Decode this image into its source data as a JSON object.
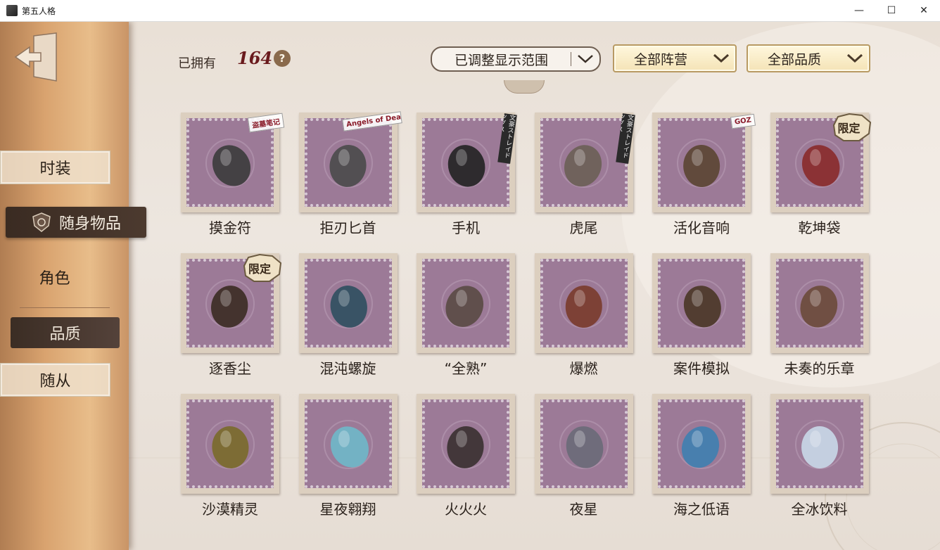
{
  "window": {
    "title": "第五人格",
    "minimize": "—",
    "maximize": "☐",
    "close": "✕"
  },
  "sidebar": {
    "items": [
      {
        "label": "时装",
        "state": "outlined"
      },
      {
        "label": "随身物品",
        "state": "active"
      },
      {
        "label": "角色",
        "state": "plain"
      },
      {
        "label": "品质",
        "state": "sub-active"
      },
      {
        "label": "随从",
        "state": "outlined"
      }
    ]
  },
  "header": {
    "owned_label": "已拥有",
    "owned_count": "164",
    "help": "?",
    "range_dropdown": "已调整显示范围",
    "faction_dropdown": "全部阵营",
    "quality_dropdown": "全部品质"
  },
  "items": [
    {
      "name": "摸金符",
      "tag": "盗墓笔记",
      "tag_style": "logo",
      "icon": "talisman-icon"
    },
    {
      "name": "拒刃匕首",
      "tag": "Angels of Death",
      "tag_style": "logo",
      "icon": "dagger-icon"
    },
    {
      "name": "手机",
      "tag": "文豪ストレイドッグス",
      "tag_style": "banner",
      "icon": "flip-phone-icon"
    },
    {
      "name": "虎尾",
      "tag": "文豪ストレイドッグス",
      "tag_style": "banner",
      "icon": "tiger-tail-icon"
    },
    {
      "name": "活化音响",
      "tag": "GOZ",
      "tag_style": "logo",
      "icon": "radio-icon"
    },
    {
      "name": "乾坤袋",
      "tag": "限定",
      "tag_style": "badge",
      "icon": "bag-icon"
    },
    {
      "name": "逐香尘",
      "tag": "限定",
      "tag_style": "badge",
      "icon": "censer-icon"
    },
    {
      "name": "混沌螺旋",
      "tag": "",
      "tag_style": "",
      "icon": "mirror-icon"
    },
    {
      "name": "“全熟”",
      "tag": "",
      "tag_style": "",
      "icon": "grill-icon"
    },
    {
      "name": "爆燃",
      "tag": "",
      "tag_style": "",
      "icon": "spark-plug-icon"
    },
    {
      "name": "案件模拟",
      "tag": "",
      "tag_style": "",
      "icon": "target-icon"
    },
    {
      "name": "未奏的乐章",
      "tag": "",
      "tag_style": "",
      "icon": "dynamite-icon"
    },
    {
      "name": "沙漠精灵",
      "tag": "",
      "tag_style": "",
      "icon": "dragonfly-icon"
    },
    {
      "name": "星夜翱翔",
      "tag": "",
      "tag_style": "",
      "icon": "crystal-bird-icon"
    },
    {
      "name": "火火火",
      "tag": "",
      "tag_style": "",
      "icon": "torch-stand-icon"
    },
    {
      "name": "夜星",
      "tag": "",
      "tag_style": "",
      "icon": "star-mace-icon"
    },
    {
      "name": "海之低语",
      "tag": "",
      "tag_style": "",
      "icon": "sea-blade-icon"
    },
    {
      "name": "全冰饮料",
      "tag": "",
      "tag_style": "",
      "icon": "ice-drink-icon"
    }
  ],
  "colors": {
    "sidebar": "#d9a36f",
    "stamp_inner": "#9c7a97",
    "count": "#6a1a1d",
    "active_nav": "#3a2b22"
  }
}
